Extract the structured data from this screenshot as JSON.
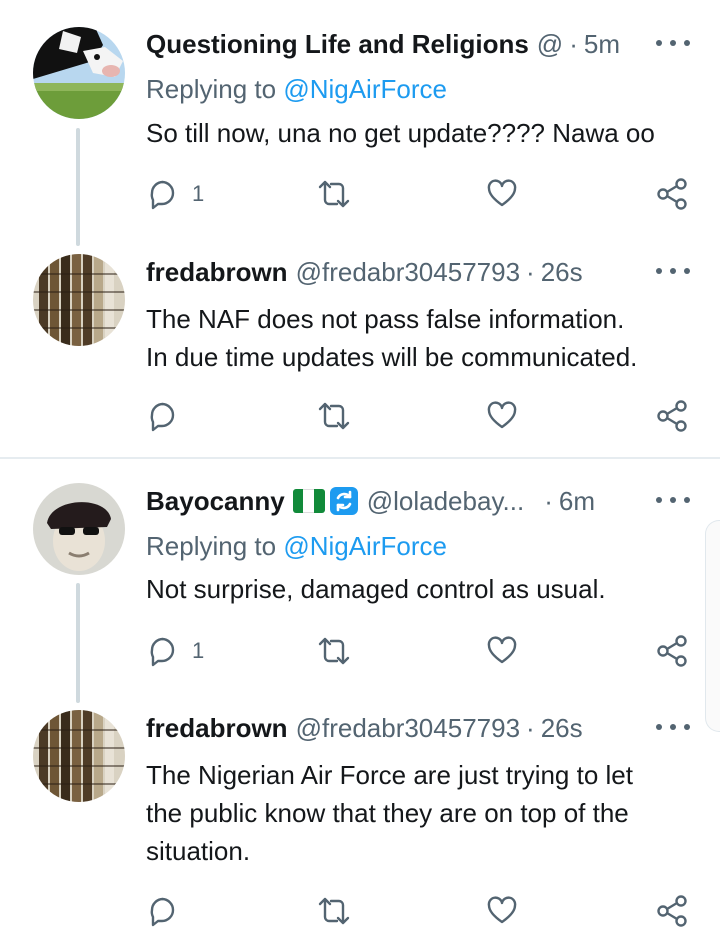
{
  "colors": {
    "accent": "#1d9bf0",
    "muted": "#536471",
    "text": "#14171a",
    "divider": "#e6ecf0",
    "thread_line": "#cfd9de"
  },
  "threads": [
    {
      "tweets": [
        {
          "display_name": "Questioning Life and Religions",
          "handle": "@",
          "time": "5m",
          "replying_prefix": "Replying to ",
          "replying_to": "@NigAirForce",
          "lines": [
            "So till now, una no get update???? Nawa oo"
          ],
          "reply_count": "1",
          "avatar_icon": "cow-avatar"
        },
        {
          "display_name": "fredabrown",
          "handle": "@fredabr30457793",
          "time": "26s",
          "lines": [
            "The NAF does not pass false information.",
            "In due time updates will be communicated."
          ],
          "reply_count": "",
          "avatar_icon": "braided-hair-avatar"
        }
      ]
    },
    {
      "tweets": [
        {
          "display_name": "Bayocanny",
          "handle": "@loladebay...",
          "time": "6m",
          "replying_prefix": "Replying to ",
          "replying_to": "@NigAirForce",
          "lines": [
            "Not surprise, damaged control as usual."
          ],
          "reply_count": "1",
          "avatar_icon": "man-with-cap-avatar",
          "badges": [
            "nigeria-flag-icon",
            "refresh-badge-icon"
          ]
        },
        {
          "display_name": "fredabrown",
          "handle": "@fredabr30457793",
          "time": "26s",
          "lines": [
            "The Nigerian Air Force are just trying to let",
            "the public know that they are on top of the",
            "situation."
          ],
          "reply_count": "",
          "avatar_icon": "braided-hair-avatar"
        }
      ]
    }
  ],
  "icons": {
    "reply": "reply-icon",
    "retweet": "retweet-icon",
    "like": "like-icon",
    "share": "share-icon",
    "more": "more-icon"
  }
}
